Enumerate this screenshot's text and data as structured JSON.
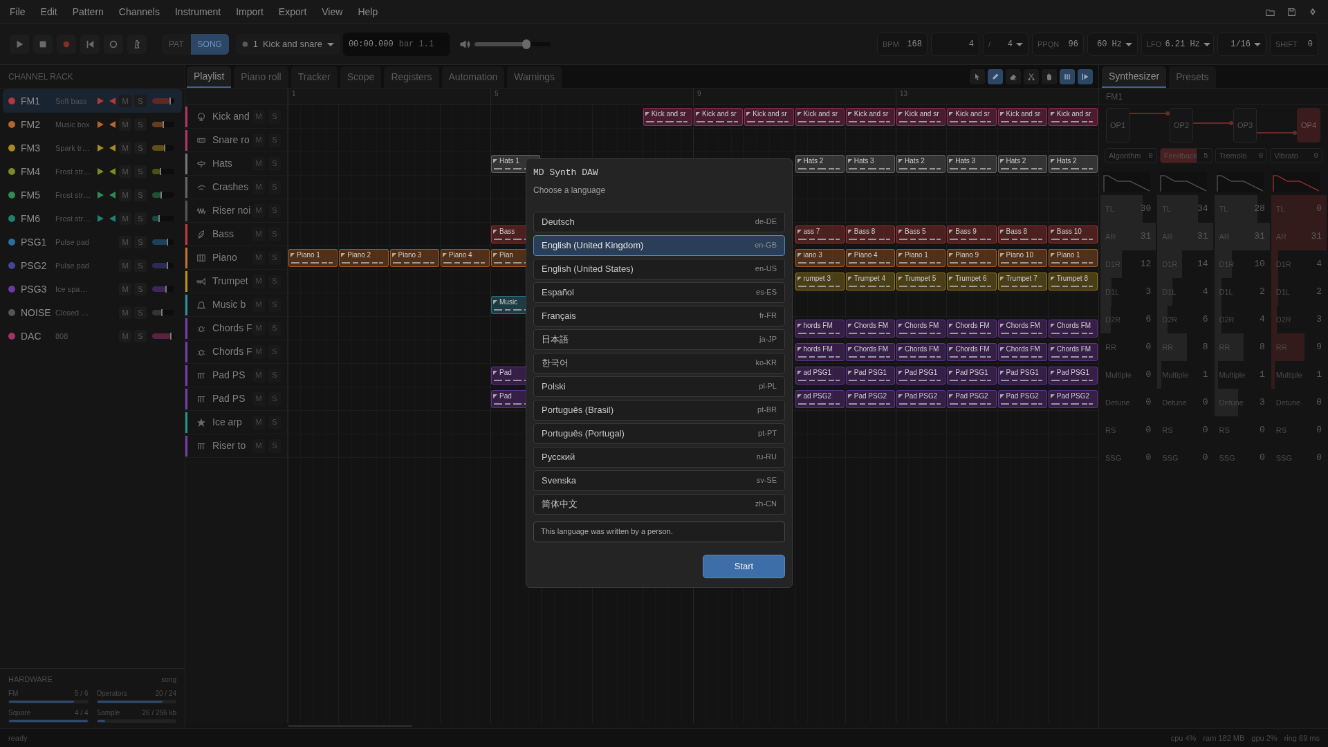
{
  "menu": [
    "File",
    "Edit",
    "Pattern",
    "Channels",
    "Instrument",
    "Import",
    "Export",
    "View",
    "Help"
  ],
  "mode_toggle": [
    {
      "label": "PAT",
      "selected": false
    },
    {
      "label": "SONG",
      "selected": true
    }
  ],
  "pattern_select": {
    "number": "1",
    "name": "Kick and snare"
  },
  "time": {
    "position": "00:00.000",
    "bar": "bar 1.1"
  },
  "volume": {
    "level": 0.68
  },
  "settings": [
    {
      "label": "BPM",
      "value": "168"
    },
    {
      "value": "4"
    },
    {
      "label": "/",
      "value": "4",
      "dropdown": true
    },
    {
      "label": "PPQN",
      "value": "96"
    },
    {
      "value": "60 Hz",
      "dropdown": true
    },
    {
      "label": "LFO",
      "value": "6.21 Hz",
      "dropdown": true
    },
    {
      "value": "1/16",
      "dropdown": true
    },
    {
      "label": "SHIFT",
      "value": "0"
    }
  ],
  "channel_rack": {
    "title": "CHANNEL RACK",
    "channels": [
      {
        "name": "FM1",
        "instrument": "Soft bass",
        "color": "#b03a3a",
        "kind": "fm",
        "selected": true,
        "level": 0.8,
        "mute_label": "M",
        "solo_label": "S"
      },
      {
        "name": "FM2",
        "instrument": "Music box",
        "color": "#b5652a",
        "kind": "fm",
        "selected": false,
        "level": 0.5,
        "mute_label": "M",
        "solo_label": "S"
      },
      {
        "name": "FM3",
        "instrument": "Spark tr…",
        "color": "#a88a22",
        "kind": "fm",
        "selected": false,
        "level": 0.55,
        "mute_label": "M",
        "solo_label": "S"
      },
      {
        "name": "FM4",
        "instrument": "Frost str…",
        "color": "#7f8a22",
        "kind": "fm",
        "selected": false,
        "level": 0.36,
        "mute_label": "M",
        "solo_label": "S"
      },
      {
        "name": "FM5",
        "instrument": "Frost str…",
        "color": "#2f8a55",
        "kind": "fm",
        "selected": false,
        "level": 0.4,
        "mute_label": "M",
        "solo_label": "S"
      },
      {
        "name": "FM6",
        "instrument": "Frost str…",
        "color": "#1f7f72",
        "kind": "fm",
        "selected": false,
        "level": 0.3,
        "mute_label": "M",
        "solo_label": "S"
      },
      {
        "name": "PSG1",
        "instrument": "Pulse pad",
        "color": "#2a6f9e",
        "kind": "psg",
        "selected": false,
        "level": 0.68,
        "mute_label": "M",
        "solo_label": "S"
      },
      {
        "name": "PSG2",
        "instrument": "Pulse pad",
        "color": "#45469a",
        "kind": "psg",
        "selected": false,
        "level": 0.68,
        "mute_label": "M",
        "solo_label": "S"
      },
      {
        "name": "PSG3",
        "instrument": "Ice spa…",
        "color": "#6a3a9e",
        "kind": "psg",
        "selected": false,
        "level": 0.62,
        "mute_label": "M",
        "solo_label": "S"
      },
      {
        "name": "NOISE",
        "instrument": "Closed …",
        "color": "#555555",
        "kind": "noise",
        "selected": false,
        "level": 0.45,
        "mute_label": "M",
        "solo_label": "S"
      },
      {
        "name": "DAC",
        "instrument": "808",
        "color": "#a03468",
        "kind": "dac",
        "selected": false,
        "level": 0.85,
        "mute_label": "M",
        "solo_label": "S"
      }
    ]
  },
  "hardware": {
    "title": "HARDWARE",
    "mode": "song",
    "meters": [
      {
        "label": "FM",
        "reading": "5 / 6",
        "level": 0.83
      },
      {
        "label": "Operators",
        "reading": "20 / 24",
        "level": 0.83
      },
      {
        "label": "Square",
        "reading": "4 / 4",
        "level": 1
      },
      {
        "label": "Sample",
        "reading": "26 / 256 kb",
        "level": 0.1
      }
    ]
  },
  "tabs": [
    {
      "label": "Playlist",
      "selected": true
    },
    {
      "label": "Piano roll",
      "selected": false
    },
    {
      "label": "Tracker",
      "selected": false
    },
    {
      "label": "Scope",
      "selected": false
    },
    {
      "label": "Registers",
      "selected": false
    },
    {
      "label": "Automation",
      "selected": false
    },
    {
      "label": "Warnings",
      "selected": false
    }
  ],
  "tools": [
    {
      "on": false
    },
    {
      "on": true
    },
    {
      "on": false
    },
    {
      "on": false
    },
    {
      "on": false
    },
    {
      "on": true
    },
    {
      "on": true
    }
  ],
  "playlist": {
    "bar_numbers": [
      "1",
      "5",
      "9",
      "13"
    ],
    "tracks": [
      {
        "name": "Kick and",
        "color": "#b8336a",
        "mute_label": "M",
        "solo_label": "S",
        "slots": [
          {
            "kind": "empty"
          },
          {
            "kind": "empty"
          },
          {
            "kind": "empty"
          },
          {
            "kind": "empty"
          },
          {
            "kind": "empty"
          },
          {
            "kind": "empty"
          },
          {
            "kind": "empty"
          },
          {
            "kind": "clip",
            "label": "Kick and sr"
          },
          {
            "kind": "clip",
            "label": "Kick and sr"
          },
          {
            "kind": "clip",
            "label": "Kick and sr"
          },
          {
            "kind": "clip",
            "label": "Kick and sr"
          },
          {
            "kind": "clip",
            "label": "Kick and sr"
          },
          {
            "kind": "clip",
            "label": "Kick and sr"
          },
          {
            "kind": "clip",
            "label": "Kick and sr"
          },
          {
            "kind": "clip",
            "label": "Kick and sr"
          },
          {
            "kind": "clip",
            "label": "Kick and sr"
          }
        ]
      },
      {
        "name": "Snare ro",
        "color": "#b8336a",
        "mute_label": "M",
        "solo_label": "S"
      },
      {
        "name": "Hats",
        "color": "#777777",
        "mute_label": "M",
        "solo_label": "S",
        "slots": [
          {
            "kind": "empty"
          },
          {
            "kind": "empty"
          },
          {
            "kind": "empty"
          },
          {
            "kind": "empty"
          },
          {
            "kind": "clip",
            "label": "Hats 1"
          },
          {
            "kind": "empty"
          },
          {
            "kind": "empty"
          },
          {
            "kind": "empty"
          },
          {
            "kind": "empty"
          },
          {
            "kind": "empty"
          },
          {
            "kind": "clip",
            "label": "Hats 2"
          },
          {
            "kind": "clip",
            "label": "Hats 3"
          },
          {
            "kind": "clip",
            "label": "Hats 2"
          },
          {
            "kind": "clip",
            "label": "Hats 3"
          },
          {
            "kind": "clip",
            "label": "Hats 2"
          },
          {
            "kind": "clip",
            "label": "Hats 2"
          }
        ]
      },
      {
        "name": "Crashes",
        "color": "#666666",
        "mute_label": "M",
        "solo_label": "S"
      },
      {
        "name": "Riser noi",
        "color": "#555555",
        "mute_label": "M",
        "solo_label": "S"
      },
      {
        "name": "Bass",
        "color": "#c23b3b",
        "mute_label": "M",
        "solo_label": "S",
        "slots": [
          {
            "kind": "empty"
          },
          {
            "kind": "empty"
          },
          {
            "kind": "empty"
          },
          {
            "kind": "empty"
          },
          {
            "kind": "clip",
            "label": "Bass"
          },
          {
            "kind": "empty"
          },
          {
            "kind": "empty"
          },
          {
            "kind": "empty"
          },
          {
            "kind": "empty"
          },
          {
            "kind": "empty"
          },
          {
            "kind": "clip",
            "label": "ass 7"
          },
          {
            "kind": "clip",
            "label": "Bass 8"
          },
          {
            "kind": "clip",
            "label": "Bass 5"
          },
          {
            "kind": "clip",
            "label": "Bass 9"
          },
          {
            "kind": "clip",
            "label": "Bass 8"
          },
          {
            "kind": "clip",
            "label": "Bass 10"
          }
        ]
      },
      {
        "name": "Piano",
        "color": "#c8702e",
        "mute_label": "M",
        "solo_label": "S",
        "slots": [
          {
            "kind": "clip",
            "label": "Piano 1"
          },
          {
            "kind": "clip",
            "label": "Piano 2"
          },
          {
            "kind": "clip",
            "label": "Piano 3"
          },
          {
            "kind": "clip",
            "label": "Piano 4"
          },
          {
            "kind": "clip",
            "label": "Pian"
          },
          {
            "kind": "empty"
          },
          {
            "kind": "empty"
          },
          {
            "kind": "empty"
          },
          {
            "kind": "empty"
          },
          {
            "kind": "empty"
          },
          {
            "kind": "clip",
            "label": "iano 3"
          },
          {
            "kind": "clip",
            "label": "Piano 4"
          },
          {
            "kind": "clip",
            "label": "Piano 1"
          },
          {
            "kind": "clip",
            "label": "Piano 9"
          },
          {
            "kind": "clip",
            "label": "Piano 10"
          },
          {
            "kind": "clip",
            "label": "Piano 1"
          }
        ]
      },
      {
        "name": "Trumpet",
        "color": "#b8961e",
        "mute_label": "M",
        "solo_label": "S",
        "slots": [
          {
            "kind": "empty"
          },
          {
            "kind": "empty"
          },
          {
            "kind": "empty"
          },
          {
            "kind": "empty"
          },
          {
            "kind": "empty"
          },
          {
            "kind": "empty"
          },
          {
            "kind": "empty"
          },
          {
            "kind": "empty"
          },
          {
            "kind": "empty"
          },
          {
            "kind": "empty"
          },
          {
            "kind": "clip",
            "label": "rumpet 3"
          },
          {
            "kind": "clip",
            "label": "Trumpet 4"
          },
          {
            "kind": "clip",
            "label": "Trumpet 5"
          },
          {
            "kind": "clip",
            "label": "Trumpet 6"
          },
          {
            "kind": "clip",
            "label": "Trumpet 7"
          },
          {
            "kind": "clip",
            "label": "Trumpet 8"
          }
        ]
      },
      {
        "name": "Music b",
        "color": "#2f8fa3",
        "mute_label": "M",
        "solo_label": "S",
        "slots": [
          {
            "kind": "empty"
          },
          {
            "kind": "empty"
          },
          {
            "kind": "empty"
          },
          {
            "kind": "empty"
          },
          {
            "kind": "clip",
            "label": "Music"
          }
        ]
      },
      {
        "name": "Chords F",
        "color": "#7a3ab0",
        "mute_label": "M",
        "solo_label": "S",
        "slots": [
          {
            "kind": "empty"
          },
          {
            "kind": "empty"
          },
          {
            "kind": "empty"
          },
          {
            "kind": "empty"
          },
          {
            "kind": "empty"
          },
          {
            "kind": "empty"
          },
          {
            "kind": "empty"
          },
          {
            "kind": "empty"
          },
          {
            "kind": "empty"
          },
          {
            "kind": "empty"
          },
          {
            "kind": "clip",
            "label": "hords FM"
          },
          {
            "kind": "clip",
            "label": "Chords FM"
          },
          {
            "kind": "clip",
            "label": "Chords FM"
          },
          {
            "kind": "clip",
            "label": "Chords FM"
          },
          {
            "kind": "clip",
            "label": "Chords FM"
          },
          {
            "kind": "clip",
            "label": "Chords FM"
          }
        ]
      },
      {
        "name": "Chords F",
        "color": "#7a3ab0",
        "mute_label": "M",
        "solo_label": "S",
        "slots": [
          {
            "kind": "empty"
          },
          {
            "kind": "empty"
          },
          {
            "kind": "empty"
          },
          {
            "kind": "empty"
          },
          {
            "kind": "empty"
          },
          {
            "kind": "empty"
          },
          {
            "kind": "empty"
          },
          {
            "kind": "empty"
          },
          {
            "kind": "empty"
          },
          {
            "kind": "empty"
          },
          {
            "kind": "clip",
            "label": "hords FM"
          },
          {
            "kind": "clip",
            "label": "Chords FM"
          },
          {
            "kind": "clip",
            "label": "Chords FM"
          },
          {
            "kind": "clip",
            "label": "Chords FM"
          },
          {
            "kind": "clip",
            "label": "Chords FM"
          },
          {
            "kind": "clip",
            "label": "Chords FM"
          }
        ]
      },
      {
        "name": "Pad PS",
        "color": "#7a3ab0",
        "mute_label": "M",
        "solo_label": "S",
        "slots": [
          {
            "kind": "empty"
          },
          {
            "kind": "empty"
          },
          {
            "kind": "empty"
          },
          {
            "kind": "empty"
          },
          {
            "kind": "clip",
            "label": "Pad"
          },
          {
            "kind": "empty"
          },
          {
            "kind": "empty"
          },
          {
            "kind": "empty"
          },
          {
            "kind": "empty"
          },
          {
            "kind": "empty"
          },
          {
            "kind": "clip",
            "label": "ad PSG1"
          },
          {
            "kind": "clip",
            "label": "Pad PSG1"
          },
          {
            "kind": "clip",
            "label": "Pad PSG1"
          },
          {
            "kind": "clip",
            "label": "Pad PSG1"
          },
          {
            "kind": "clip",
            "label": "Pad PSG1"
          },
          {
            "kind": "clip",
            "label": "Pad PSG1"
          }
        ]
      },
      {
        "name": "Pad PS",
        "color": "#7a3ab0",
        "mute_label": "M",
        "solo_label": "S",
        "slots": [
          {
            "kind": "empty"
          },
          {
            "kind": "empty"
          },
          {
            "kind": "empty"
          },
          {
            "kind": "empty"
          },
          {
            "kind": "clip",
            "label": "Pad"
          },
          {
            "kind": "empty"
          },
          {
            "kind": "empty"
          },
          {
            "kind": "empty"
          },
          {
            "kind": "empty"
          },
          {
            "kind": "empty"
          },
          {
            "kind": "clip",
            "label": "ad PSG2"
          },
          {
            "kind": "clip",
            "label": "Pad PSG2"
          },
          {
            "kind": "clip",
            "label": "Pad PSG2"
          },
          {
            "kind": "clip",
            "label": "Pad PSG2"
          },
          {
            "kind": "clip",
            "label": "Pad PSG2"
          },
          {
            "kind": "clip",
            "label": "Pad PSG2"
          }
        ]
      },
      {
        "name": "Ice arp",
        "color": "#23968a",
        "mute_label": "M",
        "solo_label": "S"
      },
      {
        "name": "Riser to",
        "color": "#7a3ab0",
        "mute_label": "M",
        "solo_label": "S"
      }
    ]
  },
  "synth_tabs": [
    {
      "label": "Synthesizer",
      "selected": true
    },
    {
      "label": "Presets",
      "selected": false
    }
  ],
  "synth": {
    "channel": "FM1",
    "operators": [
      {
        "label": "OP1",
        "selected": false
      },
      {
        "label": "OP2",
        "selected": false
      },
      {
        "label": "OP3",
        "selected": false
      },
      {
        "label": "OP4",
        "selected": true
      }
    ],
    "params": [
      {
        "label": "Algorithm",
        "value": "0",
        "level": 0
      },
      {
        "label": "Feedback",
        "value": "5",
        "level": 0.71
      },
      {
        "label": "Tremolo",
        "value": "0",
        "level": 0
      },
      {
        "label": "Vibrato",
        "value": "0",
        "level": 0
      }
    ],
    "columns": [
      {
        "rows": [
          {
            "label": "TL",
            "value": "30",
            "level": 0.76
          },
          {
            "label": "AR",
            "value": "31",
            "level": 1
          },
          {
            "label": "D1R",
            "value": "12",
            "level": 0.39
          },
          {
            "label": "D1L",
            "value": "3",
            "level": 0.2
          },
          {
            "label": "D2R",
            "value": "6",
            "level": 0.19
          },
          {
            "label": "RR",
            "value": "0",
            "level": 0
          },
          {
            "label": "Multiple",
            "value": "0",
            "level": 0
          },
          {
            "label": "Detune",
            "value": "0",
            "level": 0
          },
          {
            "label": "RS",
            "value": "0",
            "level": 0
          },
          {
            "label": "SSG",
            "value": "0",
            "level": 0
          }
        ]
      },
      {
        "rows": [
          {
            "label": "TL",
            "value": "34",
            "level": 0.73
          },
          {
            "label": "AR",
            "value": "31",
            "level": 1
          },
          {
            "label": "D1R",
            "value": "14",
            "level": 0.45
          },
          {
            "label": "D1L",
            "value": "4",
            "level": 0.27
          },
          {
            "label": "D2R",
            "value": "6",
            "level": 0.19
          },
          {
            "label": "RR",
            "value": "8",
            "level": 0.53
          },
          {
            "label": "Multiple",
            "value": "1",
            "level": 0.07
          },
          {
            "label": "Detune",
            "value": "0",
            "level": 0
          },
          {
            "label": "RS",
            "value": "0",
            "level": 0
          },
          {
            "label": "SSG",
            "value": "0",
            "level": 0
          }
        ]
      },
      {
        "rows": [
          {
            "label": "TL",
            "value": "28",
            "level": 0.78
          },
          {
            "label": "AR",
            "value": "31",
            "level": 1
          },
          {
            "label": "D1R",
            "value": "10",
            "level": 0.32
          },
          {
            "label": "D1L",
            "value": "2",
            "level": 0.13
          },
          {
            "label": "D2R",
            "value": "4",
            "level": 0.13
          },
          {
            "label": "RR",
            "value": "8",
            "level": 0.53
          },
          {
            "label": "Multiple",
            "value": "1",
            "level": 0.07
          },
          {
            "label": "Detune",
            "value": "3",
            "level": 0.43
          },
          {
            "label": "RS",
            "value": "0",
            "level": 0
          },
          {
            "label": "SSG",
            "value": "0",
            "level": 0
          }
        ]
      },
      {
        "rows": [
          {
            "label": "TL",
            "value": "0",
            "level": 1
          },
          {
            "label": "AR",
            "value": "31",
            "level": 1
          },
          {
            "label": "D1R",
            "value": "4",
            "level": 0.13
          },
          {
            "label": "D1L",
            "value": "2",
            "level": 0.13
          },
          {
            "label": "D2R",
            "value": "3",
            "level": 0.1
          },
          {
            "label": "RR",
            "value": "9",
            "level": 0.6
          },
          {
            "label": "Multiple",
            "value": "1",
            "level": 0.07
          },
          {
            "label": "Detune",
            "value": "0",
            "level": 0
          },
          {
            "label": "RS",
            "value": "0",
            "level": 0
          },
          {
            "label": "SSG",
            "value": "0",
            "level": 0
          }
        ]
      }
    ]
  },
  "status_bar": {
    "state": "ready",
    "stats": [
      "cpu 4%",
      "ram 182 MB",
      "gpu 2%",
      "ring 69 ms"
    ]
  },
  "dialog": {
    "title": "MD Synth DAW",
    "subtitle": "Choose a language",
    "languages": [
      {
        "name": "Deutsch",
        "code": "de-DE",
        "selected": false
      },
      {
        "name": "English (United Kingdom)",
        "code": "en-GB",
        "selected": true
      },
      {
        "name": "English (United States)",
        "code": "en-US",
        "selected": false
      },
      {
        "name": "Español",
        "code": "es-ES",
        "selected": false
      },
      {
        "name": "Français",
        "code": "fr-FR",
        "selected": false
      },
      {
        "name": "日本語",
        "code": "ja-JP",
        "selected": false
      },
      {
        "name": "한국어",
        "code": "ko-KR",
        "selected": false
      },
      {
        "name": "Polski",
        "code": "pl-PL",
        "selected": false
      },
      {
        "name": "Português (Brasil)",
        "code": "pt-BR",
        "selected": false
      },
      {
        "name": "Português (Portugal)",
        "code": "pt-PT",
        "selected": false
      },
      {
        "name": "Русский",
        "code": "ru-RU",
        "selected": false
      },
      {
        "name": "Svenska",
        "code": "sv-SE",
        "selected": false
      },
      {
        "name": "简体中文",
        "code": "zh-CN",
        "selected": false
      }
    ],
    "note": "This language was written by a person.",
    "button": "Start"
  }
}
